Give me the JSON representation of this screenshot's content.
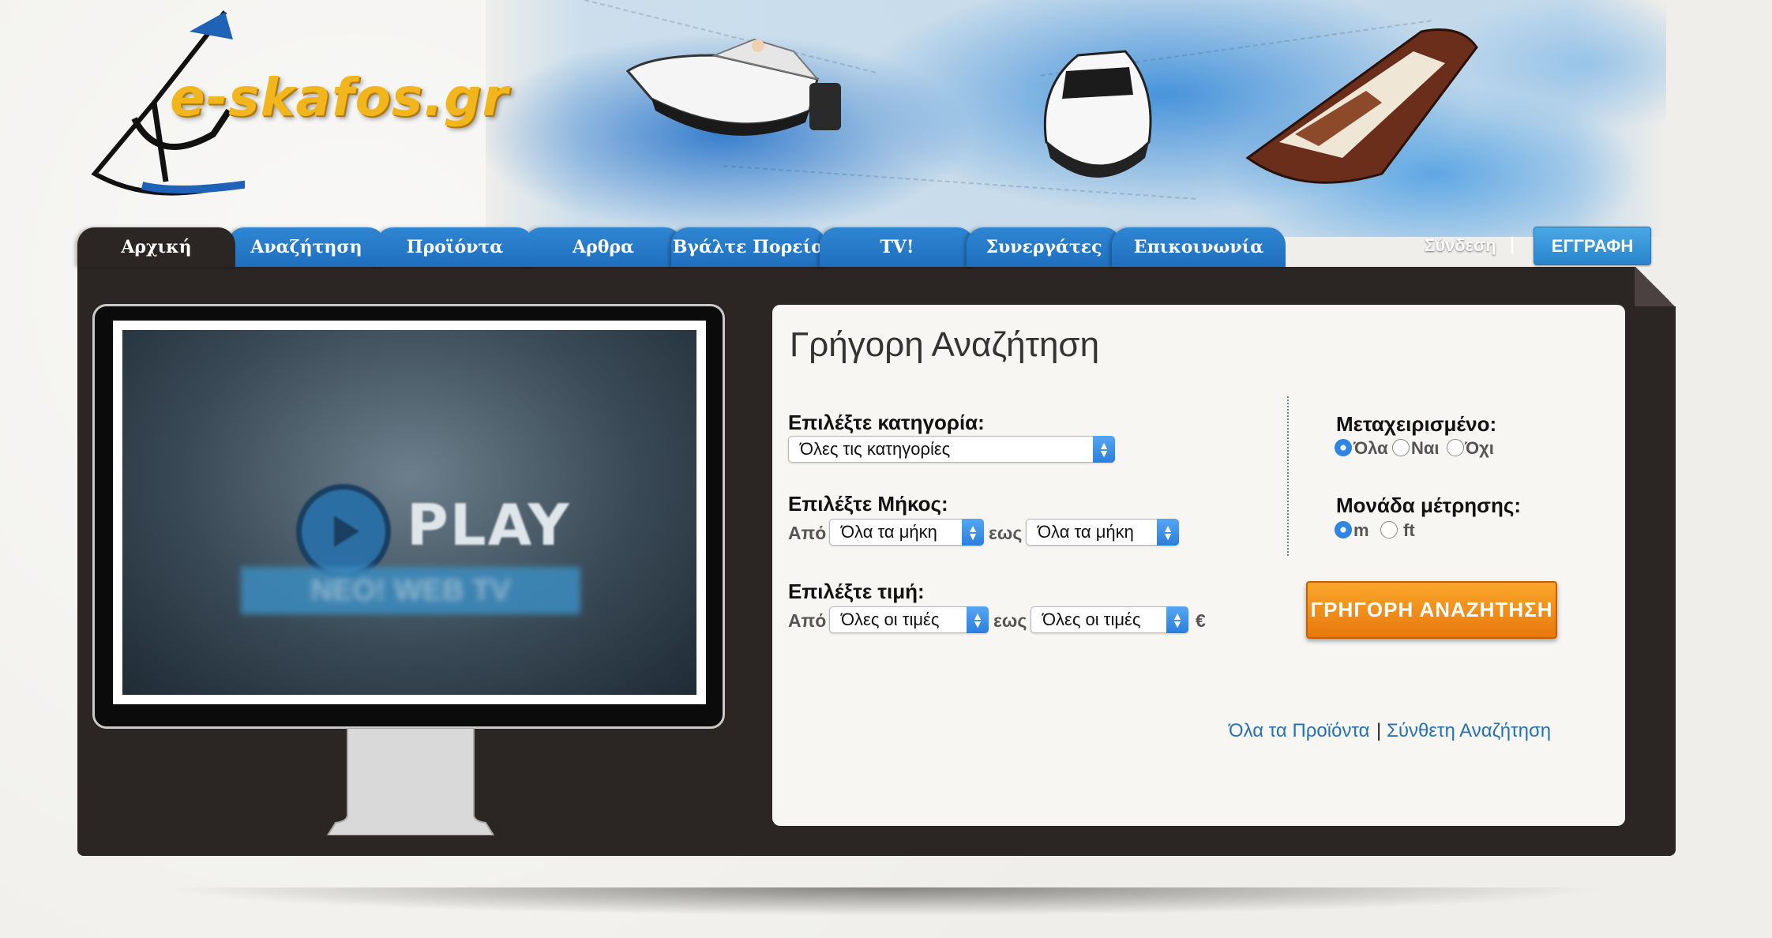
{
  "site": {
    "logo_text": "e-skafos.gr"
  },
  "nav": {
    "tabs": [
      {
        "label": "Αρχική",
        "active": true
      },
      {
        "label": "Αναζήτηση"
      },
      {
        "label": "Προϊόντα"
      },
      {
        "label": "Αρθρα"
      },
      {
        "label": "Βγάλτε Πορεία"
      },
      {
        "label": "TV!"
      },
      {
        "label": "Συνεργάτες"
      },
      {
        "label": "Επικοινωνία"
      }
    ],
    "login": "Σύνδεση",
    "separator": "|",
    "register": "ΕΓΓΡΑΦΗ"
  },
  "video": {
    "play_label": "PLAY",
    "ribbon_text": "NEO! WEB TV"
  },
  "quick_search": {
    "title": "Γρήγορη Αναζήτηση",
    "category": {
      "label": "Επιλέξτε κατηγορία:",
      "selected": "Όλες τις κατηγορίες"
    },
    "length": {
      "label": "Επιλέξτε Μήκος:",
      "from_label": "Από",
      "from_selected": "Όλα τα μήκη",
      "to_label": "εως",
      "to_selected": "Όλα τα μήκη"
    },
    "price": {
      "label": "Επιλέξτε τιμή:",
      "from_label": "Από",
      "from_selected": "Όλες οι τιμές",
      "to_label": "εως",
      "to_selected": "Όλες οι τιμές",
      "currency": "€"
    },
    "used": {
      "label": "Μεταχειρισμένο:",
      "options": [
        "Όλα",
        "Ναι",
        "Όχι"
      ],
      "selected": "Όλα"
    },
    "unit": {
      "label": "Μονάδα μέτρησης:",
      "options": [
        "m",
        "ft"
      ],
      "selected": "m"
    },
    "search_button": "ΓΡΗΓΟΡΗ ΑΝΑΖΗΤΗΣΗ",
    "all_products_link": "Όλα τα Προϊόντα",
    "links_separator": "|",
    "advanced_link": "Σύνθετη Αναζήτηση"
  },
  "colors": {
    "nav_blue": "#2f86d3",
    "panel_dark": "#2b2524",
    "accent_orange": "#f39a1f",
    "link_blue": "#2572b8"
  }
}
